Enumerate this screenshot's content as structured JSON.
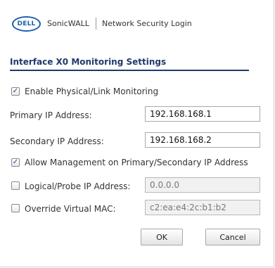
{
  "header": {
    "logo_text": "DELL",
    "brand": "SonicWALL",
    "subtitle": "Network Security Login"
  },
  "section_title": "Interface X0 Monitoring Settings",
  "enable_monitoring": {
    "label": "Enable Physical/Link Monitoring",
    "checked": true
  },
  "primary_ip": {
    "label": "Primary IP Address:",
    "value": "192.168.168.1"
  },
  "secondary_ip": {
    "label": "Secondary IP Address:",
    "value": "192.168.168.2"
  },
  "allow_management": {
    "label": "Allow Management on Primary/Secondary IP Address",
    "checked": true
  },
  "logical_probe": {
    "label": "Logical/Probe IP Address:",
    "value": "0.0.0.0",
    "checked": false
  },
  "override_mac": {
    "label": "Override Virtual MAC:",
    "value": "c2:ea:e4:2c:b1:b2",
    "checked": false
  },
  "buttons": {
    "ok": "OK",
    "cancel": "Cancel"
  },
  "colors": {
    "logo_blue": "#1d5fa8",
    "title_navy": "#1f3a6b"
  }
}
